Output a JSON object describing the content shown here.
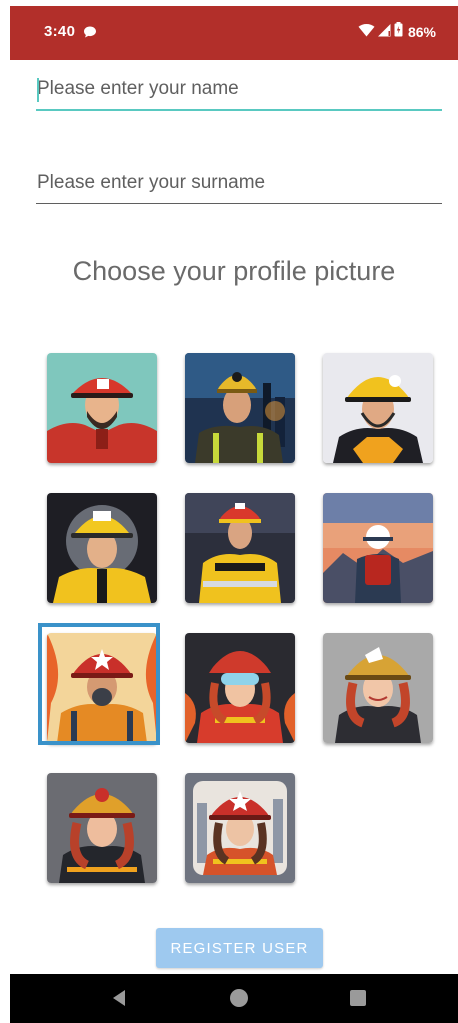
{
  "status_bar": {
    "time": "3:40",
    "battery": "86%",
    "icons": [
      "chat-icon",
      "wifi-icon",
      "signal-icon",
      "battery-icon"
    ],
    "background": "#b22f2a"
  },
  "form": {
    "name_placeholder": "Please enter your name",
    "surname_placeholder": "Please enter your surname",
    "name_value": "",
    "surname_value": ""
  },
  "heading": "Choose your profile picture",
  "avatars": {
    "count": 11,
    "selected_index": 6,
    "items": [
      {
        "id": "avatar-1",
        "theme": "firefighter-red-helmet-teal-bg"
      },
      {
        "id": "avatar-2",
        "theme": "firefighter-yellow-helmet-city-night"
      },
      {
        "id": "avatar-3",
        "theme": "firefighter-yellow-helmet-light-bg"
      },
      {
        "id": "avatar-4",
        "theme": "firefighter-yellow-helmet-dark-bg"
      },
      {
        "id": "avatar-5",
        "theme": "firefighter-full-gear-dark-bg"
      },
      {
        "id": "avatar-6",
        "theme": "firefighter-back-view-sunset"
      },
      {
        "id": "avatar-7",
        "theme": "firefighter-gas-mask-flames"
      },
      {
        "id": "avatar-8",
        "theme": "firefighter-woman-goggles-flames"
      },
      {
        "id": "avatar-9",
        "theme": "firefighter-woman-red-hair-grey-bg"
      },
      {
        "id": "avatar-10",
        "theme": "firefighter-woman-dark-bg"
      },
      {
        "id": "avatar-11",
        "theme": "firefighter-woman-city-bg"
      }
    ]
  },
  "register_button": {
    "label": "REGISTER USER",
    "color": "#9ec9ef"
  },
  "nav": {
    "icons": [
      "back-icon",
      "home-icon",
      "recents-icon"
    ]
  }
}
